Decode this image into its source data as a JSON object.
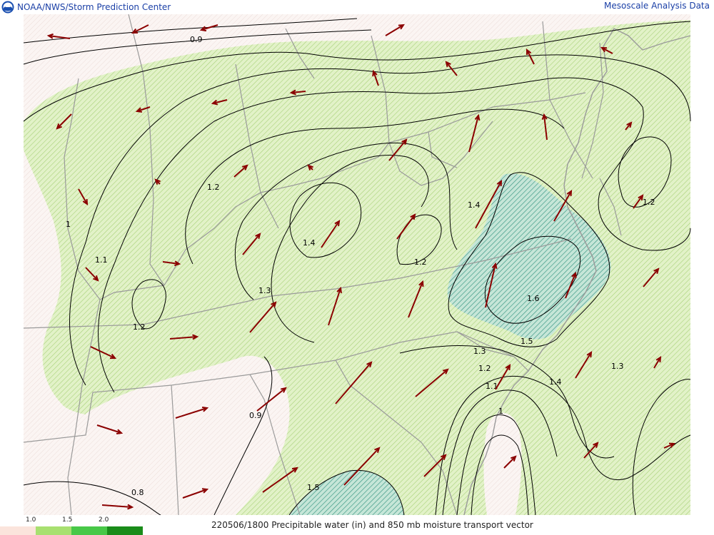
{
  "header": {
    "org_name": "NOAA/NWS/Storm Prediction Center",
    "product_name": "Mesoscale Analysis Data"
  },
  "caption": "220506/1800 Precipitable water (in) and 850 mb moisture transport vector",
  "legend": {
    "ticks": [
      "1.0",
      "1.5",
      "2.0"
    ],
    "colors": [
      "#fbe4dc",
      "#a8e070",
      "#48c848",
      "#2ea02e",
      "#1a8c1a"
    ]
  },
  "contour_labels": [
    {
      "text": "0.9"
    },
    {
      "text": "1.2"
    },
    {
      "text": "1"
    },
    {
      "text": "1.1"
    },
    {
      "text": "1.4"
    },
    {
      "text": "1.3"
    },
    {
      "text": "1.2"
    },
    {
      "text": "1.2"
    },
    {
      "text": "1.4"
    },
    {
      "text": "1.6"
    },
    {
      "text": "1.2"
    },
    {
      "text": "1.5"
    },
    {
      "text": "1.3"
    },
    {
      "text": "1.2"
    },
    {
      "text": "1.1"
    },
    {
      "text": "1.4"
    },
    {
      "text": "1.3"
    },
    {
      "text": "1"
    },
    {
      "text": "0.9"
    },
    {
      "text": "0.8"
    },
    {
      "text": "1.5"
    }
  ],
  "colors": {
    "vector": "#8b0000",
    "contour": "#000000",
    "boundary": "#9a9a9a",
    "shade_low": "#dff2c4",
    "shade_high": "#a8d8cc",
    "header_text": "#1a3fa6"
  }
}
